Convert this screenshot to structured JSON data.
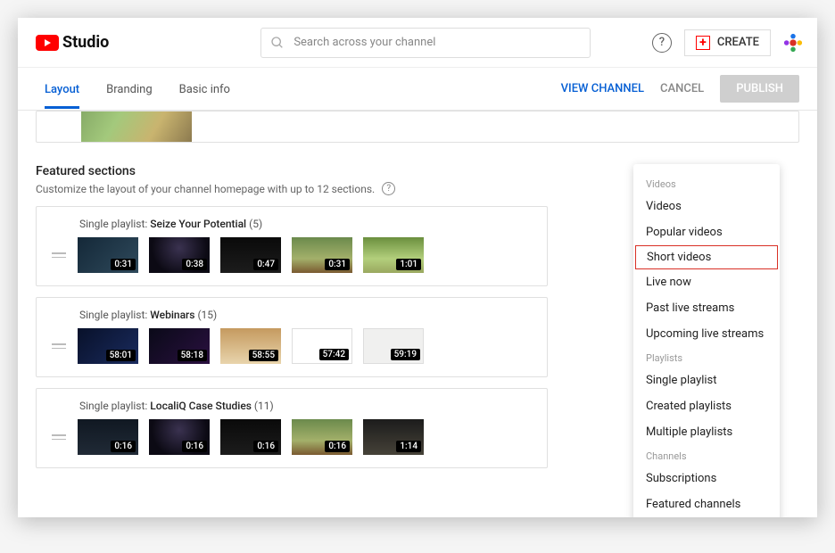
{
  "brand": {
    "name": "Studio"
  },
  "search": {
    "placeholder": "Search across your channel"
  },
  "header": {
    "create": "CREATE"
  },
  "tabs": {
    "items": [
      {
        "label": "Layout",
        "active": true
      },
      {
        "label": "Branding",
        "active": false
      },
      {
        "label": "Basic info",
        "active": false
      }
    ],
    "view_channel": "VIEW CHANNEL",
    "cancel": "CANCEL",
    "publish": "PUBLISH"
  },
  "featured": {
    "title": "Featured sections",
    "subtitle": "Customize the layout of your channel homepage with up to 12 sections."
  },
  "sections": [
    {
      "prefix": "Single playlist: ",
      "name": "Seize Your Potential",
      "count": "(5)",
      "thumbs": [
        {
          "cls": "th-a",
          "dur": "0:31"
        },
        {
          "cls": "th-b",
          "dur": "0:38"
        },
        {
          "cls": "th-c",
          "dur": "0:47"
        },
        {
          "cls": "th-d",
          "dur": "0:31"
        },
        {
          "cls": "th-e",
          "dur": "1:01"
        }
      ]
    },
    {
      "prefix": "Single playlist: ",
      "name": "Webinars",
      "count": "(15)",
      "thumbs": [
        {
          "cls": "th-f",
          "dur": "58:01"
        },
        {
          "cls": "th-g",
          "dur": "58:18"
        },
        {
          "cls": "th-h",
          "dur": "58:55"
        },
        {
          "cls": "th-i",
          "dur": "57:42"
        },
        {
          "cls": "th-j",
          "dur": "59:19"
        }
      ]
    },
    {
      "prefix": "Single playlist: ",
      "name": "LocaliQ Case Studies",
      "count": "(11)",
      "thumbs": [
        {
          "cls": "th-k",
          "dur": "0:16"
        },
        {
          "cls": "th-l",
          "dur": "0:16"
        },
        {
          "cls": "th-m",
          "dur": "0:16"
        },
        {
          "cls": "th-n",
          "dur": "0:16"
        },
        {
          "cls": "th-o",
          "dur": "1:14"
        }
      ]
    }
  ],
  "dropdown": {
    "groups": [
      {
        "title": "Videos",
        "items": [
          {
            "label": "Videos"
          },
          {
            "label": "Popular videos"
          },
          {
            "label": "Short videos",
            "selected": true
          },
          {
            "label": "Live now"
          },
          {
            "label": "Past live streams"
          },
          {
            "label": "Upcoming live streams"
          }
        ]
      },
      {
        "title": "Playlists",
        "items": [
          {
            "label": "Single playlist"
          },
          {
            "label": "Created playlists"
          },
          {
            "label": "Multiple playlists"
          }
        ]
      },
      {
        "title": "Channels",
        "items": [
          {
            "label": "Subscriptions"
          },
          {
            "label": "Featured channels"
          }
        ]
      }
    ]
  }
}
